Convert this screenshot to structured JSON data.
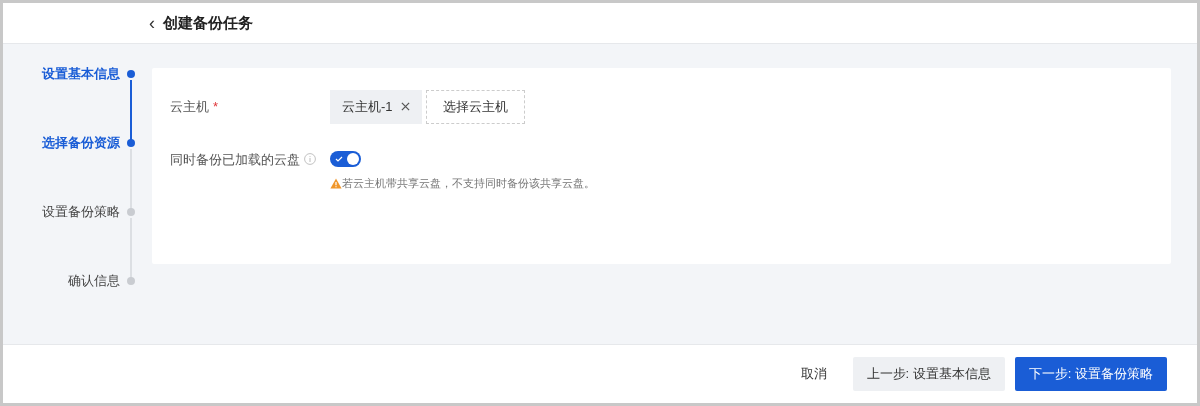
{
  "header": {
    "back": "‹",
    "title": "创建备份任务"
  },
  "steps": [
    {
      "label": "设置基本信息",
      "active": true
    },
    {
      "label": "选择备份资源",
      "active": true
    },
    {
      "label": "设置备份策略",
      "active": false
    },
    {
      "label": "确认信息",
      "active": false
    }
  ],
  "form": {
    "host": {
      "label": "云主机",
      "required_mark": "*",
      "tags": [
        {
          "label": "云主机-1"
        }
      ],
      "select_button": "选择云主机"
    },
    "attached_disks": {
      "label": "同时备份已加载的云盘",
      "on": true,
      "warning": "若云主机带共享云盘，不支持同时备份该共享云盘。"
    }
  },
  "footer": {
    "cancel": "取消",
    "prev": "上一步: 设置基本信息",
    "next": "下一步: 设置备份策略"
  }
}
